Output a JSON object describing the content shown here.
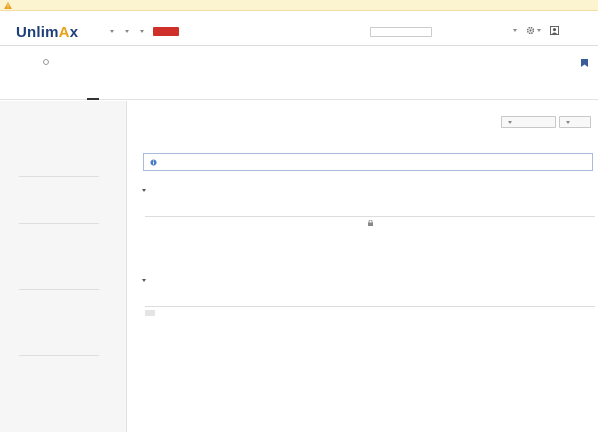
{
  "warning": {
    "text": ""
  },
  "header": {
    "logo_main": "Unlim",
    "logo_accent": "A",
    "logo_tail": "x",
    "nav": [
      {
        "label": ""
      },
      {
        "label": ""
      },
      {
        "label": ""
      }
    ],
    "create_label": "",
    "search_placeholder": "",
    "right": [
      {
        "label": ""
      },
      {
        "label": ""
      }
    ]
  },
  "project": {
    "title": "",
    "link_text": ""
  },
  "tabs": [
    {
      "label": ""
    },
    {
      "label": ""
    },
    {
      "label": ""
    },
    {
      "label": ""
    },
    {
      "label": ""
    }
  ],
  "sidebar": {
    "groups": [
      {
        "label": ""
      },
      {
        "label": ""
      },
      {
        "label": ""
      },
      {
        "label": ""
      },
      {
        "label": ""
      }
    ],
    "items": [
      {
        "label": ""
      },
      {
        "label": ""
      },
      {
        "label": ""
      },
      {
        "label": ""
      },
      {
        "label": ""
      },
      {
        "label": ""
      },
      {
        "label": ""
      },
      {
        "label": ""
      },
      {
        "label": ""
      },
      {
        "label": ""
      },
      {
        "label": ""
      },
      {
        "label": ""
      },
      {
        "label": ""
      },
      {
        "label": ""
      }
    ]
  },
  "main": {
    "title": "",
    "actions": {
      "primary": "",
      "secondary": "",
      "more": ""
    },
    "info_text": "",
    "columns": [
      "",
      "",
      "",
      "",
      ""
    ],
    "sections": [
      {
        "label": "",
        "rows": [
          {
            "name": "",
            "badge": "",
            "name2": "",
            "date": "",
            "date2": "",
            "link": "",
            "link2": "",
            "count": "",
            "op": "",
            "op2": ""
          }
        ]
      },
      {
        "label": "",
        "rows": [
          {
            "name": "",
            "badge": "",
            "name2": "",
            "date": "",
            "date2": "",
            "link": "",
            "link2": "",
            "count": "",
            "op": "",
            "op2": ""
          }
        ]
      }
    ]
  },
  "colors": {
    "brand": "#1f3f7a",
    "accent": "#e8a019",
    "create": "#d0302a",
    "link": "#2a5fb0"
  }
}
